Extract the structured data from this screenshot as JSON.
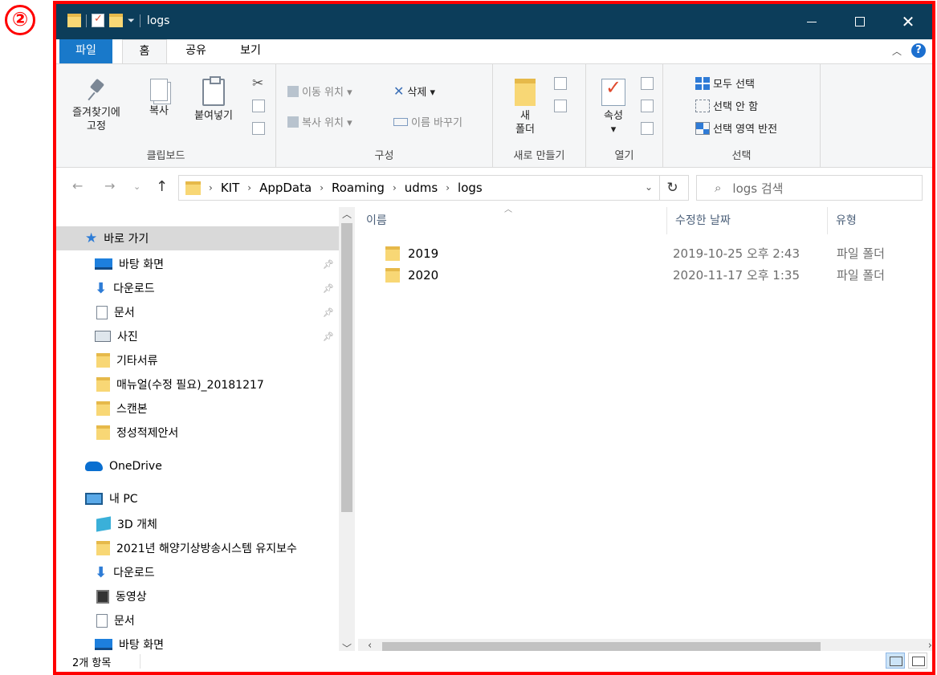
{
  "step_marker": "②",
  "window": {
    "title": "logs"
  },
  "ribbon_tabs": [
    "파일",
    "홈",
    "공유",
    "보기"
  ],
  "ribbon": {
    "clipboard": {
      "pin_label_line1": "즐겨찾기에",
      "pin_label_line2": "고정",
      "copy_label": "복사",
      "paste_label": "붙여넣기",
      "group_label": "클립보드"
    },
    "organize": {
      "move_to": "이동 위치 ▾",
      "copy_to": "복사 위치 ▾",
      "delete": "삭제 ▾",
      "rename": "이름 바꾸기",
      "group_label": "구성"
    },
    "new": {
      "new_folder_line1": "새",
      "new_folder_line2": "폴더",
      "group_label": "새로 만들기"
    },
    "open": {
      "properties": "속성",
      "group_label": "열기"
    },
    "select": {
      "select_all": "모두 선택",
      "select_none": "선택 안 함",
      "invert": "선택 영역 반전",
      "group_label": "선택"
    }
  },
  "address": {
    "crumbs": [
      "KIT",
      "AppData",
      "Roaming",
      "udms",
      "logs"
    ],
    "search_placeholder": "logs 검색"
  },
  "nav_pane": {
    "items": [
      {
        "label": "바로 가기",
        "icon": "star-icon",
        "pinned": false
      },
      {
        "label": "바탕 화면",
        "icon": "desktop-icon",
        "pinned": true
      },
      {
        "label": "다운로드",
        "icon": "download-icon",
        "pinned": true
      },
      {
        "label": "문서",
        "icon": "document-icon",
        "pinned": true
      },
      {
        "label": "사진",
        "icon": "pictures-icon",
        "pinned": true
      },
      {
        "label": "기타서류",
        "icon": "folder-icon",
        "pinned": false
      },
      {
        "label": "매뉴얼(수정 필요)_20181217",
        "icon": "folder-icon",
        "pinned": false
      },
      {
        "label": "스캔본",
        "icon": "folder-icon",
        "pinned": false
      },
      {
        "label": "정성적제안서",
        "icon": "folder-icon",
        "pinned": false
      },
      {
        "label": "OneDrive",
        "icon": "onedrive-icon",
        "pinned": false
      },
      {
        "label": "내 PC",
        "icon": "pc-icon",
        "pinned": false
      },
      {
        "label": "3D 개체",
        "icon": "3d-objects-icon",
        "pinned": false
      },
      {
        "label": "2021년 해양기상방송시스템 유지보수",
        "icon": "folder-icon",
        "pinned": false
      },
      {
        "label": "다운로드",
        "icon": "download-icon",
        "pinned": false
      },
      {
        "label": "동영상",
        "icon": "video-icon",
        "pinned": false
      },
      {
        "label": "문서",
        "icon": "document-icon",
        "pinned": false
      },
      {
        "label": "바탕 화면",
        "icon": "desktop-icon",
        "pinned": false
      }
    ]
  },
  "file_list": {
    "columns": {
      "name": "이름",
      "date": "수정한 날짜",
      "type": "유형"
    },
    "rows": [
      {
        "name": "2019",
        "date": "2019-10-25 오후 2:43",
        "type": "파일 폴더"
      },
      {
        "name": "2020",
        "date": "2020-11-17 오후 1:35",
        "type": "파일 폴더"
      }
    ]
  },
  "status": {
    "item_count": "2개 항목"
  },
  "colors": {
    "highlight_border": "#ff0000",
    "titlebar": "#0c3d5a",
    "file_tab": "#1979ca",
    "folder": "#f8d775"
  }
}
